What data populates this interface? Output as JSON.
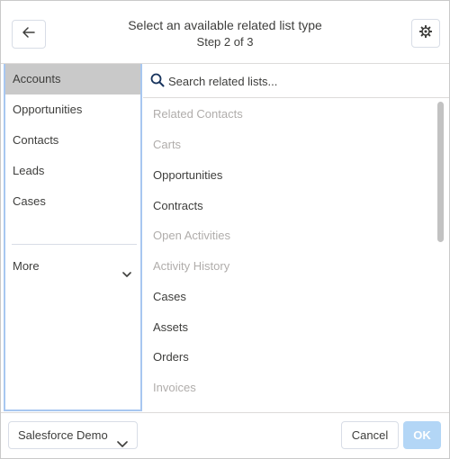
{
  "header": {
    "title": "Select an available related list type",
    "subtitle": "Step 2 of 3",
    "back_icon": "arrow-left-icon",
    "settings_icon": "gear-icon"
  },
  "left_panel": {
    "items": [
      {
        "label": "Accounts",
        "selected": true
      },
      {
        "label": "Opportunities",
        "selected": false
      },
      {
        "label": "Contacts",
        "selected": false
      },
      {
        "label": "Leads",
        "selected": false
      },
      {
        "label": "Cases",
        "selected": false
      }
    ],
    "more_label": "More"
  },
  "search": {
    "placeholder": "Search related lists..."
  },
  "related_lists": [
    {
      "label": "Related Contacts",
      "enabled": false
    },
    {
      "label": "Carts",
      "enabled": false
    },
    {
      "label": "Opportunities",
      "enabled": true
    },
    {
      "label": "Contracts",
      "enabled": true
    },
    {
      "label": "Open Activities",
      "enabled": false
    },
    {
      "label": "Activity History",
      "enabled": false
    },
    {
      "label": "Cases",
      "enabled": true
    },
    {
      "label": "Assets",
      "enabled": true
    },
    {
      "label": "Orders",
      "enabled": true
    },
    {
      "label": "Invoices",
      "enabled": false
    }
  ],
  "footer": {
    "org_label": "Salesforce Demo",
    "cancel_label": "Cancel",
    "ok_label": "OK"
  },
  "colors": {
    "selected_bg": "#c9c9c9",
    "panel_border": "#a8c7f0",
    "ok_disabled_bg": "#b3d6f6",
    "disabled_text": "#b0adab"
  }
}
